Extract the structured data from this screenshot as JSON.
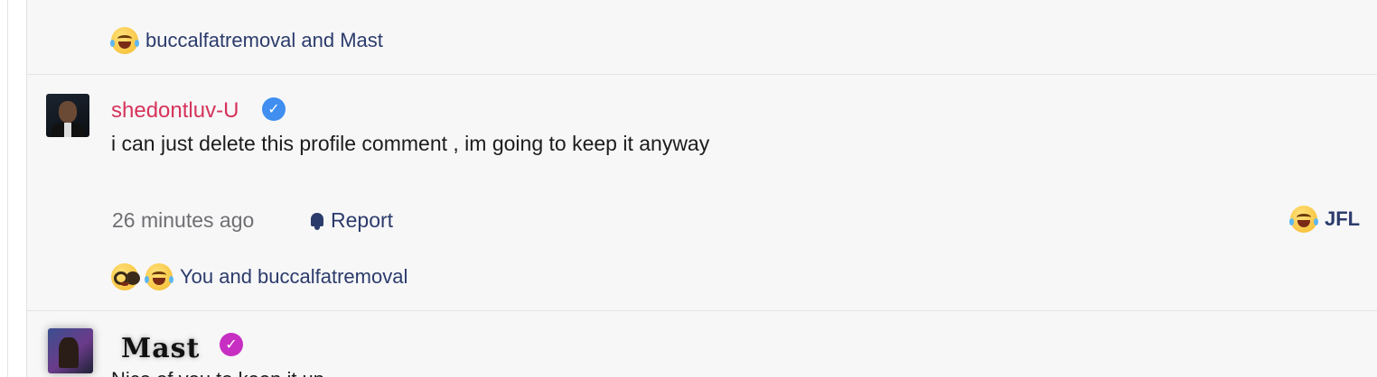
{
  "top_reactions": {
    "text": "buccalfatremoval and Mast"
  },
  "comment1": {
    "username": "shedontluv-U",
    "text": "i can just delete this profile comment , im going to keep it anyway",
    "time": "26 minutes ago",
    "report_label": "Report",
    "react_label": "JFL",
    "reactions_text": "You and buccalfatremoval"
  },
  "comment2": {
    "username": "Mast",
    "text": "Nice of you to keep it up"
  },
  "colors": {
    "username_red": "#d6335a",
    "link_navy": "#2b3b6b",
    "verified_blue": "#3f8ef0",
    "verified_purple": "#c72fc2"
  },
  "icons": [
    "laughing-tears-emoji-icon",
    "nerd-face-emoji-icon",
    "verified-check-icon",
    "bell-icon"
  ]
}
